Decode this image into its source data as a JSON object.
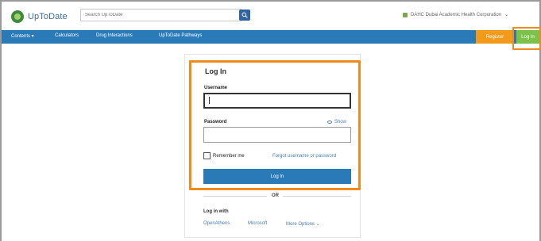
{
  "header": {
    "logo_text": "UpToDate",
    "search_placeholder": "Search UpToDate",
    "organization": "DAHC Dubai Academic Health Corporation",
    "org_chevron": "⌄"
  },
  "nav": {
    "items": [
      {
        "label": "Contents ▾"
      },
      {
        "label": "Calculators"
      },
      {
        "label": "Drug Interactions"
      },
      {
        "label": "UpToDate Pathways"
      }
    ],
    "register_label": "Register",
    "login_label": "Log In"
  },
  "login": {
    "title": "Log In",
    "username_label": "Username",
    "username_value": "",
    "password_label": "Password",
    "password_value": "",
    "show_label": "Show",
    "remember_label": "Remember me",
    "forgot_label": "Forgot username or password",
    "submit_label": "Log In",
    "or_label": "OR",
    "login_with_label": "Log in with",
    "sso_options": [
      {
        "label": "OpenAthens"
      },
      {
        "label": "Microsoft"
      },
      {
        "label": "More Options ⌄"
      }
    ]
  },
  "colors": {
    "nav_blue": "#2a7ab8",
    "register_orange": "#f19a1c",
    "login_green": "#7cc24a",
    "highlight_orange": "#f08a1a"
  }
}
